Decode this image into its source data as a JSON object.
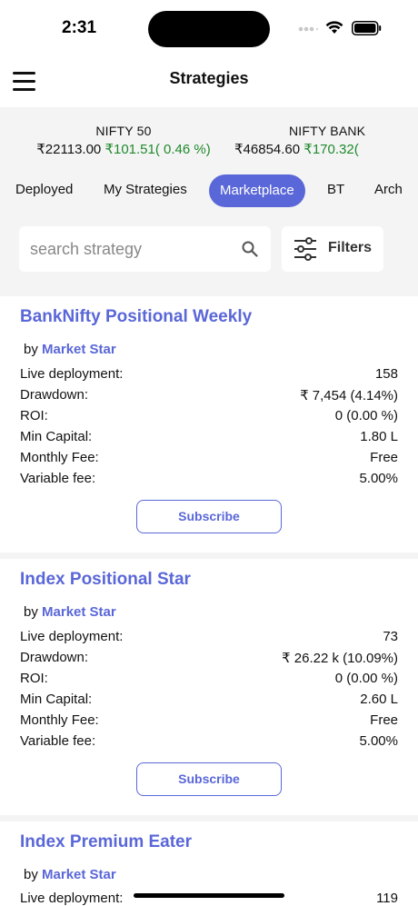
{
  "status": {
    "time": "2:31"
  },
  "header": {
    "title": "Strategies"
  },
  "indices": [
    {
      "name": "NIFTY 50",
      "price": "₹22113.00",
      "change": "₹101.51( 0.46 %)"
    },
    {
      "name": "NIFTY BANK",
      "price": "₹46854.60",
      "change": "₹170.32("
    }
  ],
  "tabs": [
    {
      "label": "Deployed"
    },
    {
      "label": "My Strategies"
    },
    {
      "label": "Marketplace",
      "active": true
    },
    {
      "label": "BT"
    },
    {
      "label": "Arch"
    }
  ],
  "search": {
    "placeholder": "search strategy",
    "value": ""
  },
  "filters": {
    "label": "Filters"
  },
  "labels": {
    "by": "by",
    "live_deployment": "Live deployment:",
    "drawdown": "Drawdown:",
    "roi": "ROI:",
    "min_capital": "Min Capital:",
    "monthly_fee": "Monthly Fee:",
    "variable_fee": "Variable fee:",
    "subscribe": "Subscribe"
  },
  "strategies": [
    {
      "title": "BankNifty Positional Weekly",
      "author": "Market Star",
      "live_deployment": "158",
      "drawdown": "₹ 7,454 (4.14%)",
      "roi": "0 (0.00 %)",
      "min_capital": "1.80 L",
      "monthly_fee": "Free",
      "variable_fee": "5.00%"
    },
    {
      "title": "Index Positional Star",
      "author": "Market Star",
      "live_deployment": "73",
      "drawdown": "₹ 26.22 k (10.09%)",
      "roi": "0 (0.00 %)",
      "min_capital": "2.60 L",
      "monthly_fee": "Free",
      "variable_fee": "5.00%"
    },
    {
      "title": "Index Premium Eater",
      "author": "Market Star",
      "live_deployment": "119"
    }
  ],
  "colors": {
    "accent": "#5a67d8",
    "positive": "#1f8a2c",
    "background": "#f4f4f4"
  }
}
